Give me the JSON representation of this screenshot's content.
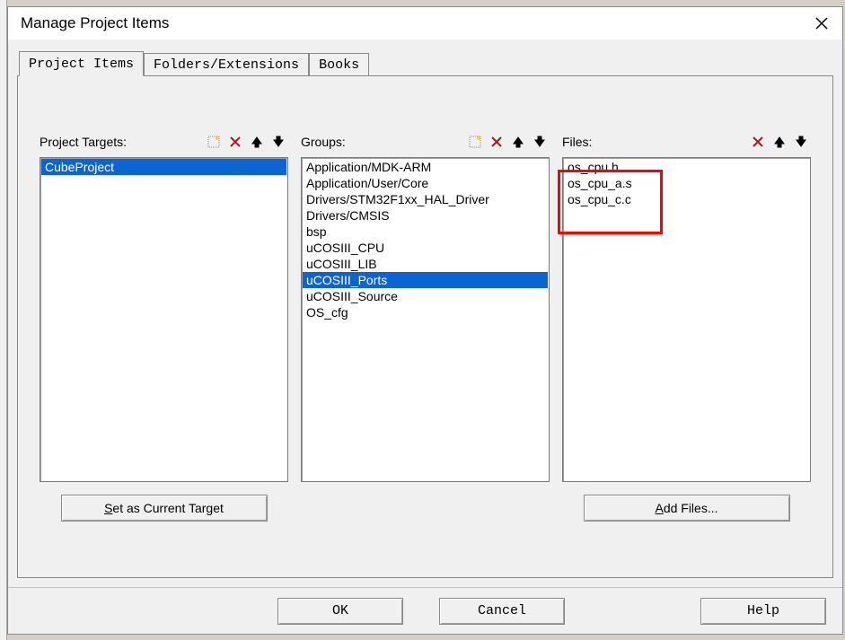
{
  "dialog": {
    "title": "Manage Project Items"
  },
  "tabs": {
    "project_items": "Project Items",
    "folders_extensions": "Folders/Extensions",
    "books": "Books"
  },
  "columns": {
    "targets": {
      "label": "Project Targets:",
      "items": [
        "CubeProject"
      ],
      "selected_index": 0,
      "button": "Set as Current Target"
    },
    "groups": {
      "label": "Groups:",
      "items": [
        "Application/MDK-ARM",
        "Application/User/Core",
        "Drivers/STM32F1xx_HAL_Driver",
        "Drivers/CMSIS",
        "bsp",
        "uCOSIII_CPU",
        "uCOSIII_LIB",
        "uCOSIII_Ports",
        "uCOSIII_Source",
        "OS_cfg"
      ],
      "selected_index": 7
    },
    "files": {
      "label": "Files:",
      "items": [
        "os_cpu.h",
        "os_cpu_a.s",
        "os_cpu_c.c"
      ],
      "button": "Add Files..."
    }
  },
  "buttons": {
    "ok": "OK",
    "cancel": "Cancel",
    "help": "Help"
  }
}
